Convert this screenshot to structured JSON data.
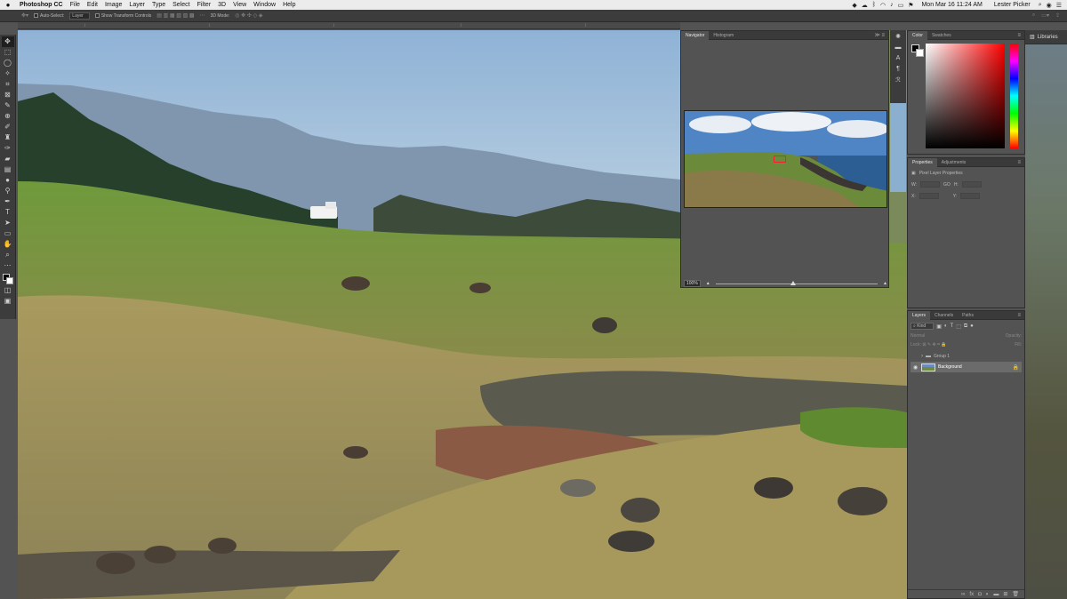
{
  "menubar": {
    "apple": "",
    "app_name": "Photoshop CC",
    "menus": [
      "File",
      "Edit",
      "Image",
      "Layer",
      "Type",
      "Select",
      "Filter",
      "3D",
      "View",
      "Window",
      "Help"
    ],
    "datetime": "Mon Mar 16  11:24 AM",
    "user": "Lester Picker"
  },
  "options_bar": {
    "auto_select_label": "Auto-Select:",
    "auto_select_target": "Layer",
    "transform_label": "Show Transform Controls",
    "mode_3d_label": "3D Mode:"
  },
  "navigator": {
    "tabs": [
      "Navigator",
      "Histogram"
    ],
    "zoom": "100%"
  },
  "color_panel": {
    "tabs": [
      "Color",
      "Swatches"
    ]
  },
  "properties_panel": {
    "tabs": [
      "Properties",
      "Adjustments"
    ],
    "title": "Pixel Layer Properties",
    "w_label": "W:",
    "h_label": "H:",
    "x_label": "X:",
    "y_label": "Y:",
    "link_label": "GO"
  },
  "layers_panel": {
    "tabs": [
      "Layers",
      "Channels",
      "Paths"
    ],
    "filter_kind": "Kind",
    "blend_mode": "Normal",
    "opacity_label": "Opacity:",
    "lock_label": "Lock:",
    "fill_label": "Fill:",
    "layers": [
      {
        "name": "Group 1",
        "type": "group",
        "selected": false
      },
      {
        "name": "Background",
        "type": "pixel",
        "selected": true
      }
    ]
  },
  "libraries": {
    "label": "Libraries"
  }
}
